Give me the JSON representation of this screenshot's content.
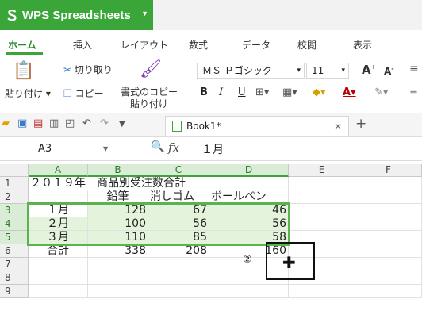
{
  "app": {
    "title": "WPS Spreadsheets",
    "logo_icon": "wps-s-logo",
    "accent": "#3aa63a"
  },
  "ribbon_tabs": [
    {
      "label": "ホーム",
      "active": true
    },
    {
      "label": "挿入"
    },
    {
      "label": "レイアウト"
    },
    {
      "label": "数式"
    },
    {
      "label": "データ"
    },
    {
      "label": "校閲"
    },
    {
      "label": "表示"
    }
  ],
  "ribbon": {
    "paste_label": "貼り付け",
    "cut_label": "切り取り",
    "copy_label": "コピー",
    "format_copy_label": "書式のコピー",
    "format_paste_label": "貼り付け",
    "font_name": "ＭＳ Ｐゴシック",
    "font_size": "11",
    "bold": "B",
    "italic": "I",
    "underline": "U",
    "font_grow": "A",
    "font_shrink": "A"
  },
  "document": {
    "tab_name": "Book1*",
    "close": "×",
    "new_tab": "+"
  },
  "formula_bar": {
    "name_box": "A3",
    "fx": "fx",
    "value": "１月"
  },
  "columns": [
    "A",
    "B",
    "C",
    "D",
    "E",
    "F"
  ],
  "rows": [
    "1",
    "2",
    "3",
    "4",
    "5",
    "6",
    "7",
    "8",
    "9"
  ],
  "cells": {
    "A1": "２０１９年　商品別受注数合計",
    "B2": "鉛筆",
    "C2": "消しゴム",
    "D2": "ボールペン",
    "A3": "１月",
    "B3": "128",
    "C3": "67",
    "D3": "46",
    "A4": "２月",
    "B4": "100",
    "C4": "56",
    "D4": "56",
    "A5": "３月",
    "B5": "110",
    "C5": "85",
    "D5": "58",
    "A6": "合計",
    "B6": "338",
    "C6": "208",
    "D6": "160"
  },
  "annotation": {
    "marker": "②",
    "cursor": "✚"
  }
}
